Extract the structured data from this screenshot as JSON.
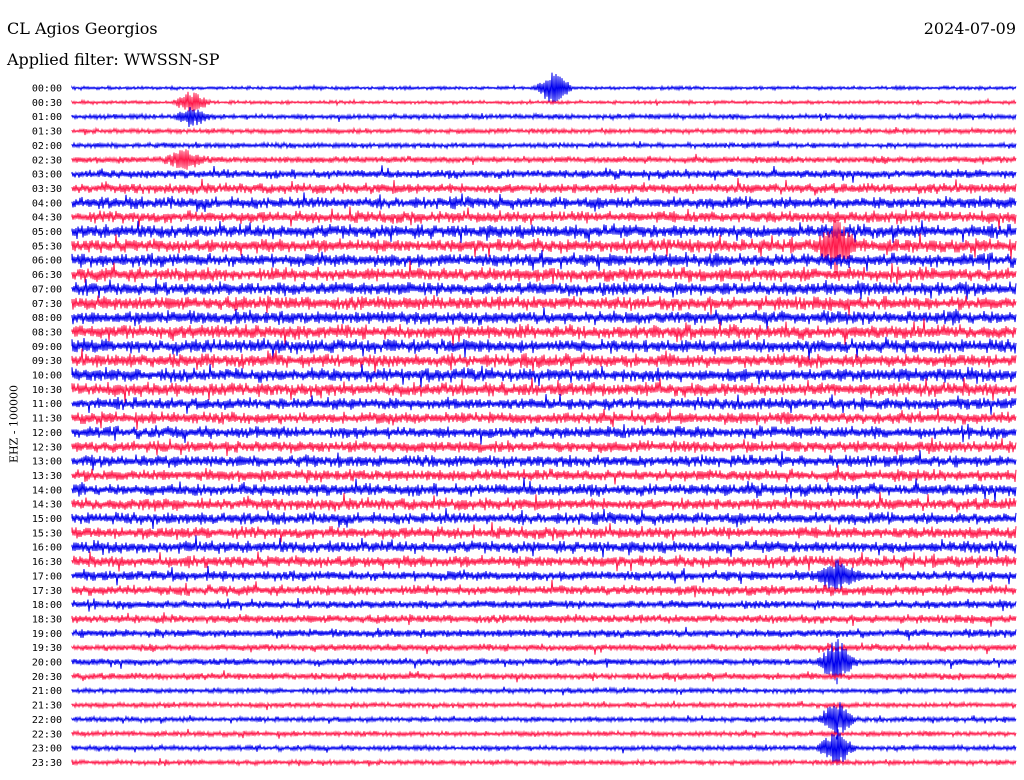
{
  "header": {
    "station": "CL Agios Georgios",
    "date": "2024-07-09",
    "filter": "Applied filter: WWSSN-SP"
  },
  "chart_data": {
    "type": "line",
    "title": "CL Agios Georgios",
    "ylabel": "EHZ - 100000",
    "tick_labels": [
      "00:00",
      "00:30",
      "01:00",
      "01:30",
      "02:00",
      "02:30",
      "03:00",
      "03:30",
      "04:00",
      "04:30",
      "05:00",
      "05:30",
      "06:00",
      "06:30",
      "07:00",
      "07:30",
      "08:00",
      "08:30",
      "09:00",
      "09:30",
      "10:00",
      "10:30",
      "11:00",
      "11:30",
      "12:00",
      "12:30",
      "13:00",
      "13:30",
      "14:00",
      "14:30",
      "15:00",
      "15:30",
      "16:00",
      "16:30",
      "17:00",
      "17:30",
      "18:00",
      "18:30",
      "19:00",
      "19:30",
      "20:00",
      "20:30",
      "21:00",
      "21:30",
      "22:00",
      "22:30",
      "23:00",
      "23:30"
    ],
    "series_colors": [
      "#0000ee",
      "#ff1a4b"
    ],
    "grid": false,
    "amplitude": [
      2,
      2,
      3,
      3,
      3,
      4,
      5,
      6,
      7,
      7,
      8,
      8,
      8,
      8,
      8,
      8,
      8,
      8,
      8,
      8,
      8,
      8,
      7,
      7,
      7,
      7,
      7,
      7,
      7,
      7,
      7,
      7,
      7,
      7,
      6,
      6,
      5,
      5,
      5,
      4,
      4,
      4,
      3,
      3,
      3,
      3,
      3,
      3
    ],
    "events": [
      {
        "trace": 0,
        "x_min": 15.3,
        "amplitude": 8
      },
      {
        "trace": 1,
        "x_min": 3.8,
        "amplitude": 5
      },
      {
        "trace": 2,
        "x_min": 3.8,
        "amplitude": 4
      },
      {
        "trace": 5,
        "x_min": 3.6,
        "amplitude": 4
      },
      {
        "trace": 11,
        "x_min": 24.3,
        "amplitude": 10
      },
      {
        "trace": 34,
        "x_min": 24.3,
        "amplitude": 6
      },
      {
        "trace": 40,
        "x_min": 24.3,
        "amplitude": 10
      },
      {
        "trace": 44,
        "x_min": 24.3,
        "amplitude": 8
      },
      {
        "trace": 46,
        "x_min": 24.3,
        "amplitude": 8
      }
    ]
  }
}
